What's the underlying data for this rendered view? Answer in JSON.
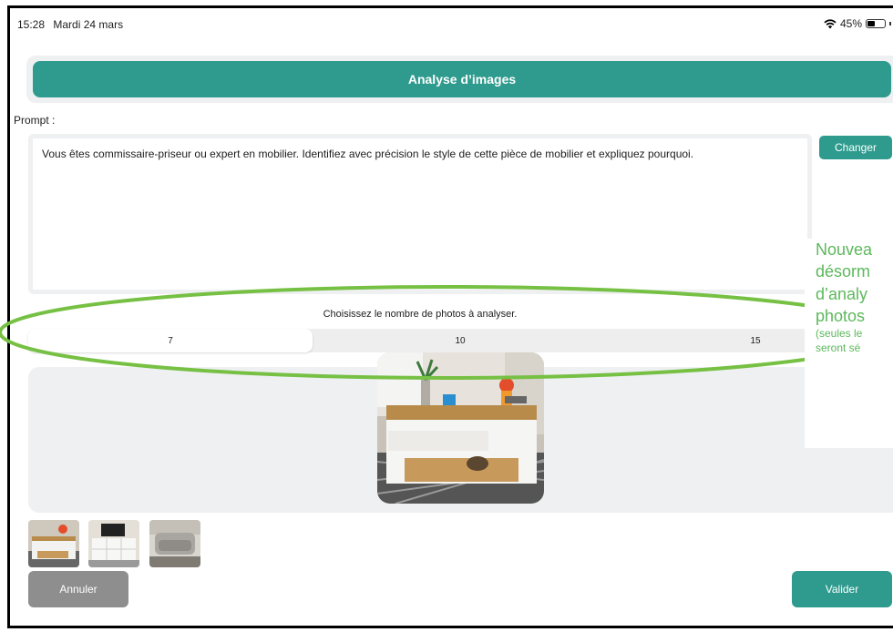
{
  "status_bar": {
    "time": "15:28",
    "date": "Mardi 24 mars",
    "battery": "45%"
  },
  "header": {
    "title": "Analyse d’images"
  },
  "prompt": {
    "label": "Prompt :",
    "text": "Vous êtes commissaire-priseur ou expert en mobilier. Identifiez avec précision le style de cette pièce de mobilier et expliquez pourquoi.",
    "change_label": "Changer"
  },
  "photo_count": {
    "label": "Choisissez le nombre de photos à analyser.",
    "options": [
      "7",
      "10",
      "15"
    ],
    "selected": "7"
  },
  "actions": {
    "cancel": "Annuler",
    "validate": "Valider"
  },
  "annotation": {
    "lines": [
      "Nouvea",
      "désorm",
      "d’analy",
      "photos"
    ],
    "small_lines": [
      "(seules le",
      "seront sé"
    ]
  },
  "colors": {
    "accent": "#2e9b8e",
    "cancel": "#8e8e8e",
    "annotation": "#5cb85c"
  },
  "icons": [
    "wifi-icon",
    "battery-icon"
  ]
}
